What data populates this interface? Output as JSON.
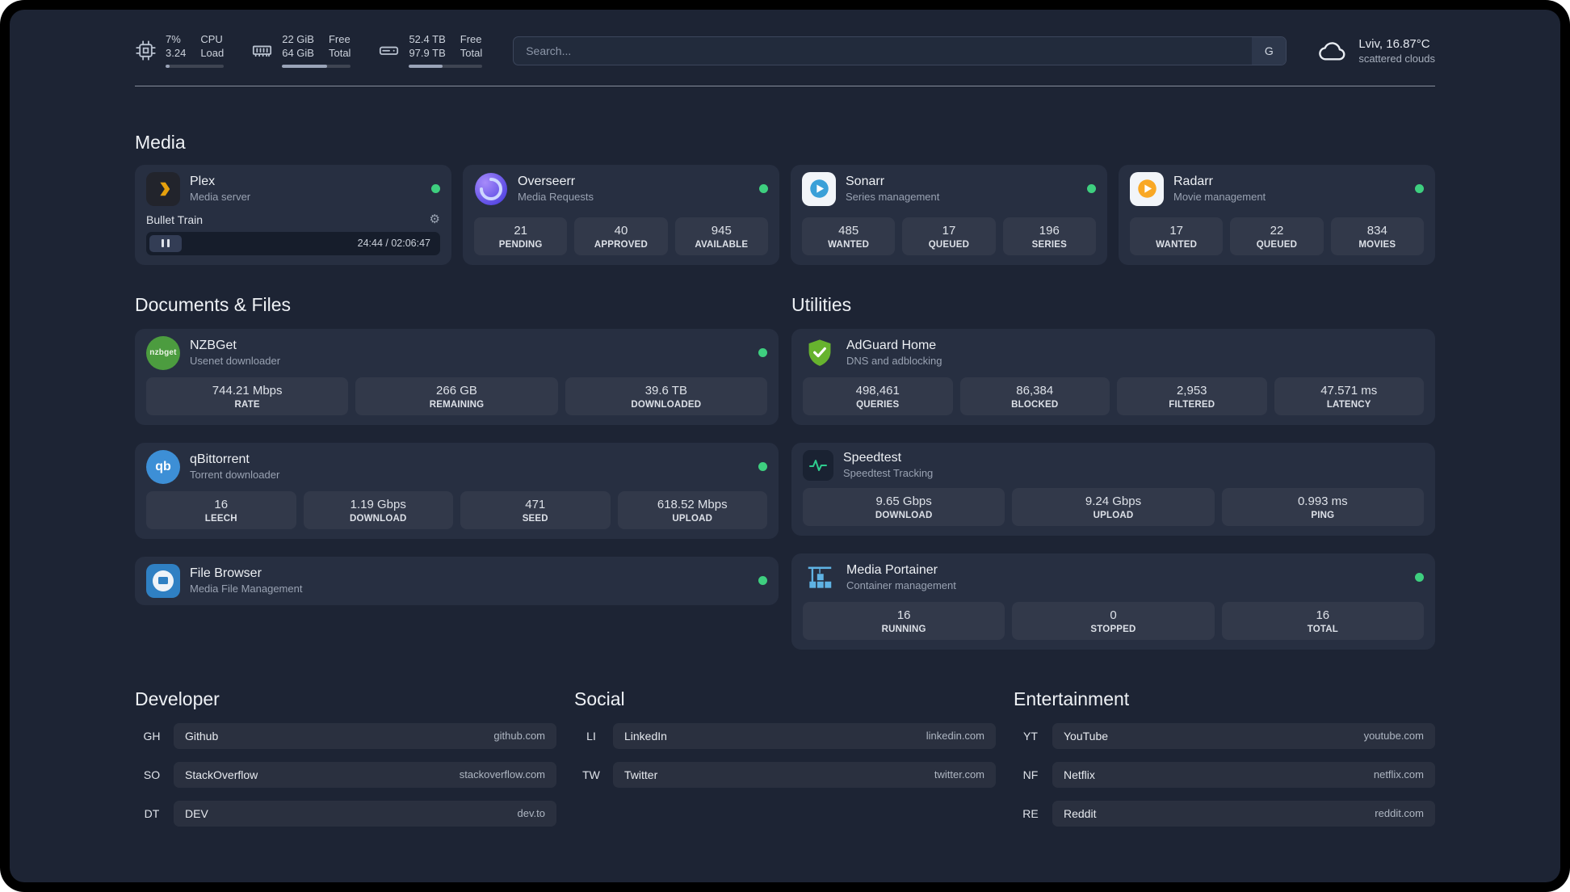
{
  "header": {
    "cpu": {
      "value1": "7%",
      "label1": "CPU",
      "value2": "3.24",
      "label2": "Load",
      "bar_percent": 7
    },
    "memory": {
      "value1": "22 GiB",
      "label1": "Free",
      "value2": "64 GiB",
      "label2": "Total",
      "bar_percent": 66
    },
    "disk": {
      "value1": "52.4 TB",
      "label1": "Free",
      "value2": "97.9 TB",
      "label2": "Total",
      "bar_percent": 46
    },
    "search": {
      "placeholder": "Search...",
      "button": "G"
    },
    "weather": {
      "location": "Lviv, 16.87°C",
      "condition": "scattered clouds"
    }
  },
  "sections": {
    "media": {
      "title": "Media"
    },
    "documents": {
      "title": "Documents & Files"
    },
    "utilities": {
      "title": "Utilities"
    },
    "developer": {
      "title": "Developer"
    },
    "social": {
      "title": "Social"
    },
    "entertainment": {
      "title": "Entertainment"
    }
  },
  "services": {
    "plex": {
      "name": "Plex",
      "desc": "Media server",
      "now_playing": "Bullet Train",
      "time": "24:44 / 02:06:47"
    },
    "overseerr": {
      "name": "Overseerr",
      "desc": "Media Requests",
      "stats": [
        {
          "value": "21",
          "label": "PENDING"
        },
        {
          "value": "40",
          "label": "APPROVED"
        },
        {
          "value": "945",
          "label": "AVAILABLE"
        }
      ]
    },
    "sonarr": {
      "name": "Sonarr",
      "desc": "Series management",
      "stats": [
        {
          "value": "485",
          "label": "WANTED"
        },
        {
          "value": "17",
          "label": "QUEUED"
        },
        {
          "value": "196",
          "label": "SERIES"
        }
      ]
    },
    "radarr": {
      "name": "Radarr",
      "desc": "Movie management",
      "stats": [
        {
          "value": "17",
          "label": "WANTED"
        },
        {
          "value": "22",
          "label": "QUEUED"
        },
        {
          "value": "834",
          "label": "MOVIES"
        }
      ]
    },
    "nzbget": {
      "name": "NZBGet",
      "desc": "Usenet downloader",
      "icon_text": "nzbget",
      "stats": [
        {
          "value": "744.21 Mbps",
          "label": "RATE"
        },
        {
          "value": "266 GB",
          "label": "REMAINING"
        },
        {
          "value": "39.6 TB",
          "label": "DOWNLOADED"
        }
      ]
    },
    "qbittorrent": {
      "name": "qBittorrent",
      "desc": "Torrent downloader",
      "icon_text": "qb",
      "stats": [
        {
          "value": "16",
          "label": "LEECH"
        },
        {
          "value": "1.19 Gbps",
          "label": "DOWNLOAD"
        },
        {
          "value": "471",
          "label": "SEED"
        },
        {
          "value": "618.52 Mbps",
          "label": "UPLOAD"
        }
      ]
    },
    "filebrowser": {
      "name": "File Browser",
      "desc": "Media File Management"
    },
    "adguard": {
      "name": "AdGuard Home",
      "desc": "DNS and adblocking",
      "stats": [
        {
          "value": "498,461",
          "label": "QUERIES"
        },
        {
          "value": "86,384",
          "label": "BLOCKED"
        },
        {
          "value": "2,953",
          "label": "FILTERED"
        },
        {
          "value": "47.571 ms",
          "label": "LATENCY"
        }
      ]
    },
    "speedtest": {
      "name": "Speedtest",
      "desc": "Speedtest Tracking",
      "stats": [
        {
          "value": "9.65 Gbps",
          "label": "DOWNLOAD"
        },
        {
          "value": "9.24 Gbps",
          "label": "UPLOAD"
        },
        {
          "value": "0.993 ms",
          "label": "PING"
        }
      ]
    },
    "portainer": {
      "name": "Media Portainer",
      "desc": "Container management",
      "stats": [
        {
          "value": "16",
          "label": "RUNNING"
        },
        {
          "value": "0",
          "label": "STOPPED"
        },
        {
          "value": "16",
          "label": "TOTAL"
        }
      ]
    }
  },
  "bookmarks": {
    "developer": [
      {
        "abbr": "GH",
        "name": "Github",
        "url": "github.com"
      },
      {
        "abbr": "SO",
        "name": "StackOverflow",
        "url": "stackoverflow.com"
      },
      {
        "abbr": "DT",
        "name": "DEV",
        "url": "dev.to"
      }
    ],
    "social": [
      {
        "abbr": "LI",
        "name": "LinkedIn",
        "url": "linkedin.com"
      },
      {
        "abbr": "TW",
        "name": "Twitter",
        "url": "twitter.com"
      }
    ],
    "entertainment": [
      {
        "abbr": "YT",
        "name": "YouTube",
        "url": "youtube.com"
      },
      {
        "abbr": "NF",
        "name": "Netflix",
        "url": "netflix.com"
      },
      {
        "abbr": "RE",
        "name": "Reddit",
        "url": "reddit.com"
      }
    ]
  },
  "icons": {
    "cpu_chip_icon": "svg-chip-outline",
    "ram_icon": "svg-ram-outline",
    "hard_drive_icon": "svg-drive-outline",
    "cloud_icon": "svg-cloud-outline",
    "gear_icon": "⚙",
    "pause_icon": "❚❚",
    "status_dot": "●"
  },
  "colors": {
    "page_bg": "#1d2434",
    "card_bg": "#272f41",
    "status_green": "#3ecf7f",
    "plex_orange": "#e5a00d",
    "sonarr_blue": "#3aa0d8",
    "radarr_amber": "#f9a825",
    "adguard_green": "#67b32e",
    "speedtest_green": "#2ecc8e",
    "portainer_blue": "#5fb3e4",
    "qbittorrent_blue": "#3d8fd6",
    "nzbget_green": "#4c9c3f",
    "filebrowser_blue": "#2f80c3",
    "overseerr_purple": "#5a4fe0"
  }
}
